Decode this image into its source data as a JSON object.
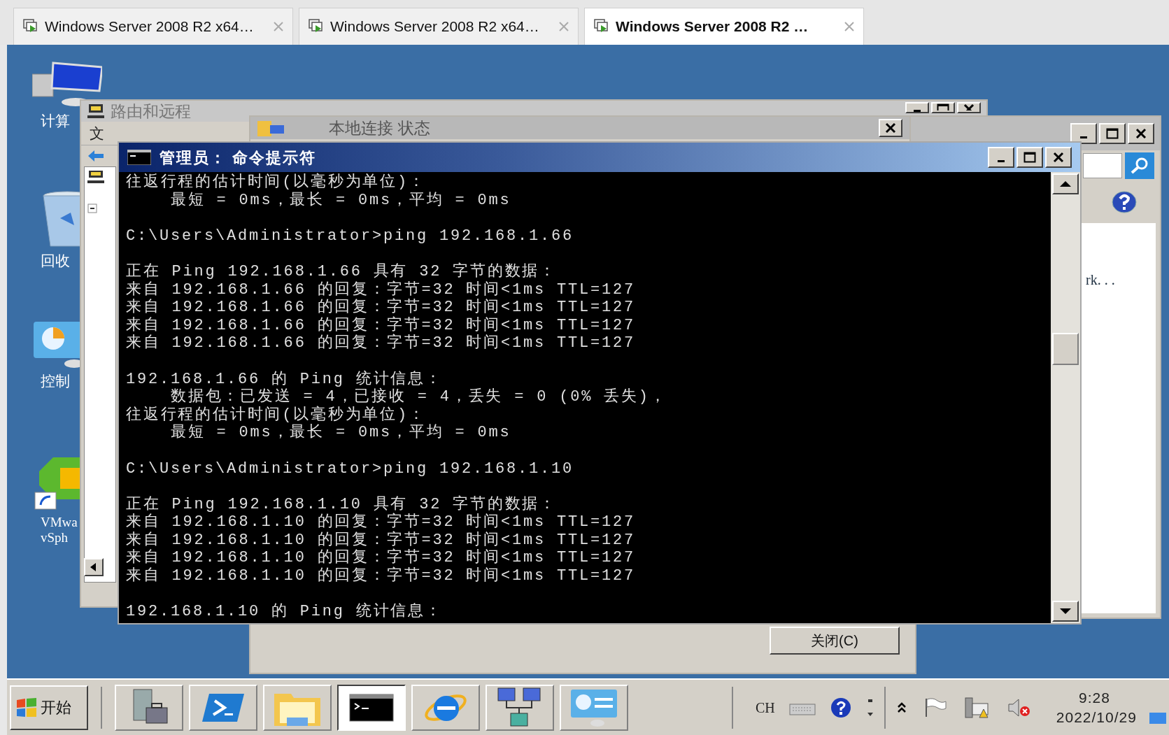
{
  "browser_tabs": [
    {
      "label": "Windows Server 2008 R2 x64…",
      "selected": false
    },
    {
      "label": "Windows Server 2008 R2 x64…",
      "selected": false
    },
    {
      "label": "Windows Server 2008 R2 …",
      "selected": true
    }
  ],
  "desktop_icons": [
    {
      "kind": "computer",
      "lines": [
        "计算"
      ]
    },
    {
      "kind": "recycle",
      "lines": [
        "回收"
      ]
    },
    {
      "kind": "control",
      "lines": [
        "控制"
      ]
    },
    {
      "kind": "vsphere",
      "lines": [
        "VMwa",
        "vSph"
      ]
    }
  ],
  "routing_window": {
    "title": "路由和远程",
    "menu": "文"
  },
  "status_window": {
    "title": "本地连接 状态",
    "close_button": "关闭(C)"
  },
  "help_window": {
    "text": "rk. . ."
  },
  "cmd_window": {
    "title": "管理员： 命令提示符",
    "blocks": [
      [
        "往返行程的估计时间(以毫秒为单位)：",
        "    最短 = 0ms，最长 = 0ms，平均 = 0ms"
      ],
      [
        "C:\\Users\\Administrator>ping 192.168.1.66"
      ],
      [
        "正在 Ping 192.168.1.66 具有 32 字节的数据：",
        "来自 192.168.1.66 的回复：字节=32 时间<1ms TTL=127",
        "来自 192.168.1.66 的回复：字节=32 时间<1ms TTL=127",
        "来自 192.168.1.66 的回复：字节=32 时间<1ms TTL=127",
        "来自 192.168.1.66 的回复：字节=32 时间<1ms TTL=127"
      ],
      [
        "192.168.1.66 的 Ping 统计信息：",
        "    数据包：已发送 = 4，已接收 = 4，丢失 = 0 (0% 丢失)，",
        "往返行程的估计时间(以毫秒为单位)：",
        "    最短 = 0ms，最长 = 0ms，平均 = 0ms"
      ],
      [
        "C:\\Users\\Administrator>ping 192.168.1.10"
      ],
      [
        "正在 Ping 192.168.1.10 具有 32 字节的数据：",
        "来自 192.168.1.10 的回复：字节=32 时间<1ms TTL=127",
        "来自 192.168.1.10 的回复：字节=32 时间<1ms TTL=127",
        "来自 192.168.1.10 的回复：字节=32 时间<1ms TTL=127",
        "来自 192.168.1.10 的回复：字节=32 时间<1ms TTL=127"
      ],
      [
        "192.168.1.10 的 Ping 统计信息："
      ]
    ]
  },
  "taskbar": {
    "start": "开始",
    "apps": [
      {
        "kind": "server",
        "selected": false
      },
      {
        "kind": "powershell",
        "selected": false
      },
      {
        "kind": "folder",
        "selected": false
      },
      {
        "kind": "cmd",
        "selected": true
      },
      {
        "kind": "ie",
        "selected": false
      },
      {
        "kind": "network",
        "selected": false
      },
      {
        "kind": "control",
        "selected": false
      }
    ],
    "language": "CH",
    "time": "9:28",
    "date": "2022/10/29"
  }
}
